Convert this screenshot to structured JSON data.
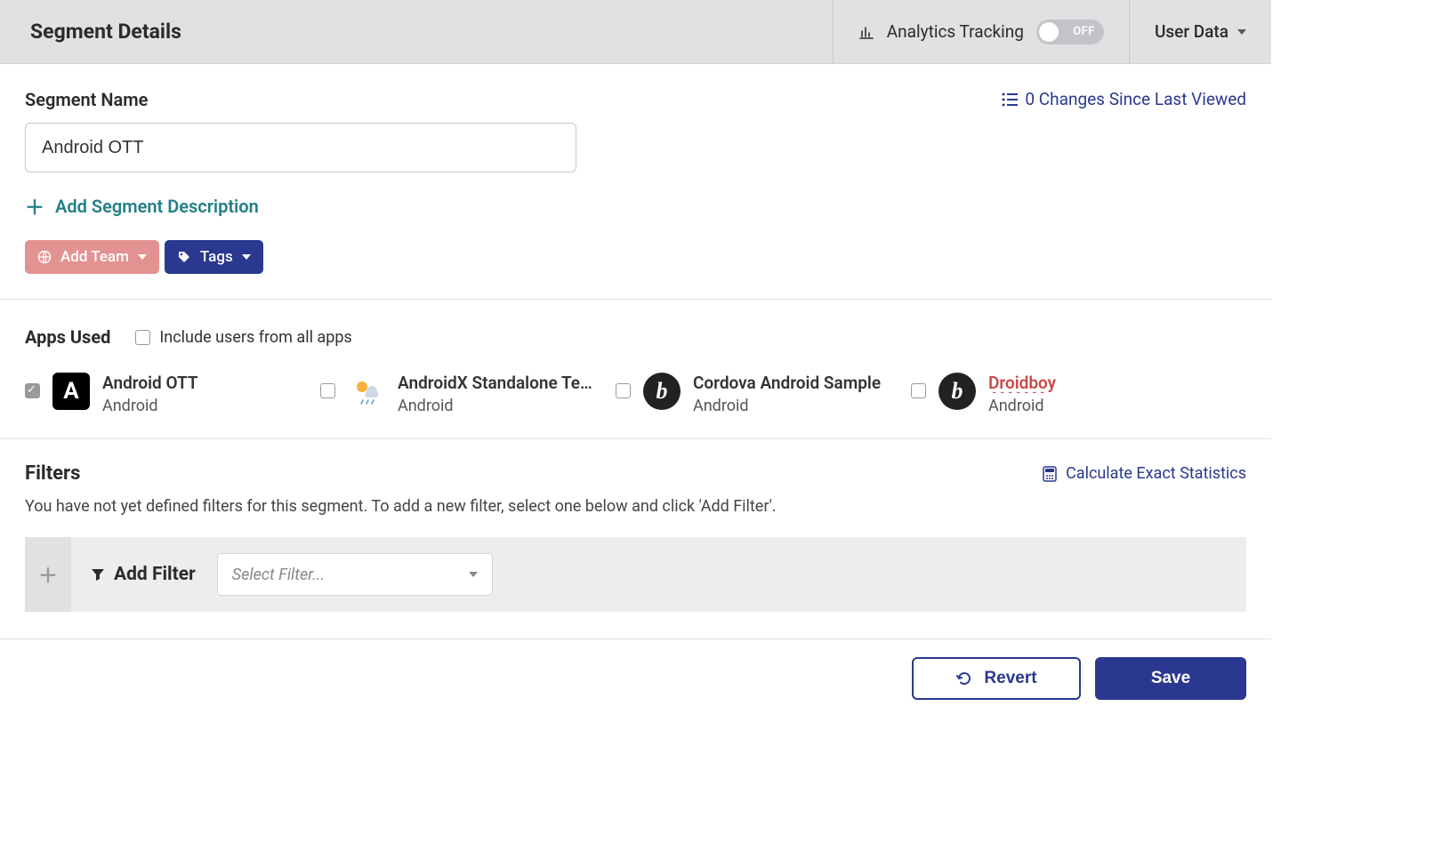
{
  "header": {
    "title": "Segment Details",
    "analytics_label": "Analytics Tracking",
    "toggle_state": "OFF",
    "user_data_label": "User Data"
  },
  "segment": {
    "name_label": "Segment Name",
    "name_value": "Android OTT",
    "changes_text": "0 Changes Since Last Viewed",
    "add_description_label": "Add Segment Description",
    "add_team_label": "Add Team",
    "tags_label": "Tags"
  },
  "apps": {
    "section_title": "Apps Used",
    "include_all_label": "Include users from all apps",
    "items": [
      {
        "name": "Android OTT",
        "platform": "Android",
        "checked": true,
        "icon": "A",
        "icon_style": "black"
      },
      {
        "name": "AndroidX Standalone Te…",
        "platform": "Android",
        "checked": false,
        "icon": "weather",
        "icon_style": "wht"
      },
      {
        "name": "Cordova Android Sample",
        "platform": "Android",
        "checked": false,
        "icon": "b",
        "icon_style": "dark"
      },
      {
        "name": "Droidboy",
        "platform": "Android",
        "checked": false,
        "icon": "b",
        "icon_style": "dark",
        "name_red": true
      }
    ]
  },
  "filters": {
    "section_title": "Filters",
    "calc_label": "Calculate Exact Statistics",
    "empty_message": "You have not yet defined filters for this segment. To add a new filter, select one below and click 'Add Filter'.",
    "add_filter_label": "Add Filter",
    "select_placeholder": "Select Filter..."
  },
  "footer": {
    "revert_label": "Revert",
    "save_label": "Save"
  }
}
